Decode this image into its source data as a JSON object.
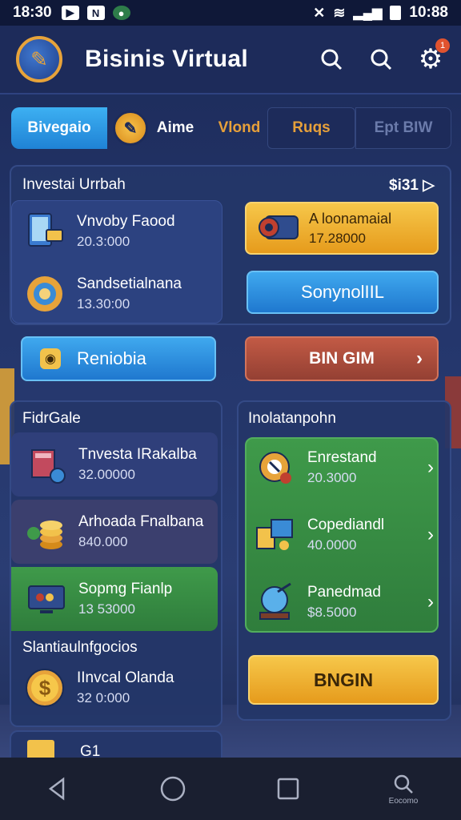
{
  "status_bar": {
    "time": "18:30",
    "left_icons": [
      "youtube-icon",
      "news-icon",
      "game-icon"
    ],
    "right_time": "10:88"
  },
  "header": {
    "title": "Bisinis Virtual",
    "icons": [
      "search-icon",
      "search-icon",
      "gear-icon"
    ],
    "badge": "1"
  },
  "tabs": {
    "active": "Bivegaio",
    "aime": "Aime",
    "vlond": "Vlond",
    "ruqs": "Ruqs",
    "epb": "Ept BIW"
  },
  "invest": {
    "title": "Investai Urrbah",
    "amount": "$i31",
    "items": [
      {
        "name": "Vnvoby Faood",
        "value": "20.3:000"
      },
      {
        "name": "Sandsetialnana",
        "value": "13.30:00"
      }
    ],
    "featured": {
      "name": "A loonamaial",
      "value": "17.28000"
    },
    "btn_sonny": "SonynolIIL",
    "btn_reniobia": "Reniobia",
    "btn_bingim": "BIN GIM"
  },
  "fund": {
    "title": "FidrGale",
    "items": [
      {
        "name": "Tnvesta IRakalba",
        "value": "32.00000"
      },
      {
        "name": "Arhoada Fnalbana",
        "value": "840.000"
      },
      {
        "name": "Sopmg Fianlp",
        "value": "13 53000"
      }
    ],
    "sub_title": "Slantiaulnfgocios",
    "sub_item": {
      "name": "IInvcal Olanda",
      "value": "32 0:000"
    },
    "partial": "G1"
  },
  "inst": {
    "title": "Inolatanpohn",
    "items": [
      {
        "name": "Enrestand",
        "value": "20.3000"
      },
      {
        "name": "Copediandl",
        "value": "40.0000"
      },
      {
        "name": "Panedmad",
        "value": "$8.5000"
      }
    ],
    "btn_bngin": "BNGIN"
  },
  "navbar": {
    "search_label": "Eocomo"
  },
  "colors": {
    "accent_yellow": "#f6c74a",
    "accent_blue": "#3fa8ee",
    "accent_green": "#3f9a4a",
    "accent_red": "#c25a45",
    "background": "#24366c"
  }
}
